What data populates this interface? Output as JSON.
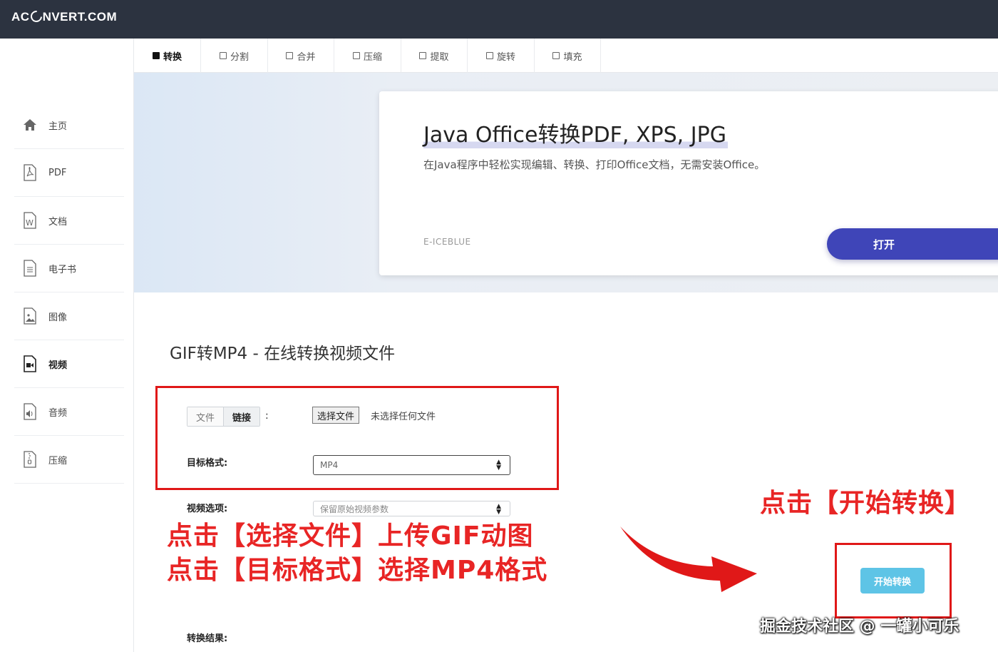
{
  "brand": {
    "logo_text_left": "AC",
    "logo_text_right": "NVERT.COM"
  },
  "sidebar": {
    "items": [
      {
        "label": "主页",
        "icon": "home-icon"
      },
      {
        "label": "PDF",
        "icon": "pdf-file-icon"
      },
      {
        "label": "文档",
        "icon": "word-file-icon"
      },
      {
        "label": "电子书",
        "icon": "ebook-file-icon"
      },
      {
        "label": "图像",
        "icon": "image-file-icon"
      },
      {
        "label": "视频",
        "icon": "video-file-icon",
        "active": true
      },
      {
        "label": "音频",
        "icon": "audio-file-icon"
      },
      {
        "label": "压缩",
        "icon": "archive-file-icon"
      }
    ]
  },
  "tabs": [
    {
      "label": "转换",
      "active": true
    },
    {
      "label": "分割"
    },
    {
      "label": "合并"
    },
    {
      "label": "压缩"
    },
    {
      "label": "提取"
    },
    {
      "label": "旋转"
    },
    {
      "label": "填充"
    }
  ],
  "banner": {
    "title": "Java Office转换PDF, XPS, JPG",
    "description": "在Java程序中轻松实现编辑、转换、打印Office文档，无需安装Office。",
    "brand": "E-ICEBLUE",
    "button_label": "打开"
  },
  "main": {
    "page_title": "GIF转MP4 - 在线转换视频文件",
    "source_tabs": {
      "file": "文件",
      "link": "链接"
    },
    "colon": ":",
    "choose_file_button": "选择文件",
    "no_file_text": "未选择任何文件",
    "target_format_label": "目标格式:",
    "target_format_value": "MP4",
    "video_options_label": "视频选项:",
    "video_options_value": "保留原始视频参数",
    "start_button": "开始转换",
    "result_label": "转换结果:"
  },
  "annotations": {
    "left_line1": "点击【选择文件】上传GIF动图",
    "left_line2": "点击【目标格式】选择MP4格式",
    "right": "点击【开始转换】"
  },
  "watermark": "掘金技术社区 @ 一罐小可乐",
  "colors": {
    "topbar": "#2c3340",
    "primary_button": "#3f45b8",
    "start_button": "#5ec4e6",
    "annotation_red": "#e82525"
  }
}
